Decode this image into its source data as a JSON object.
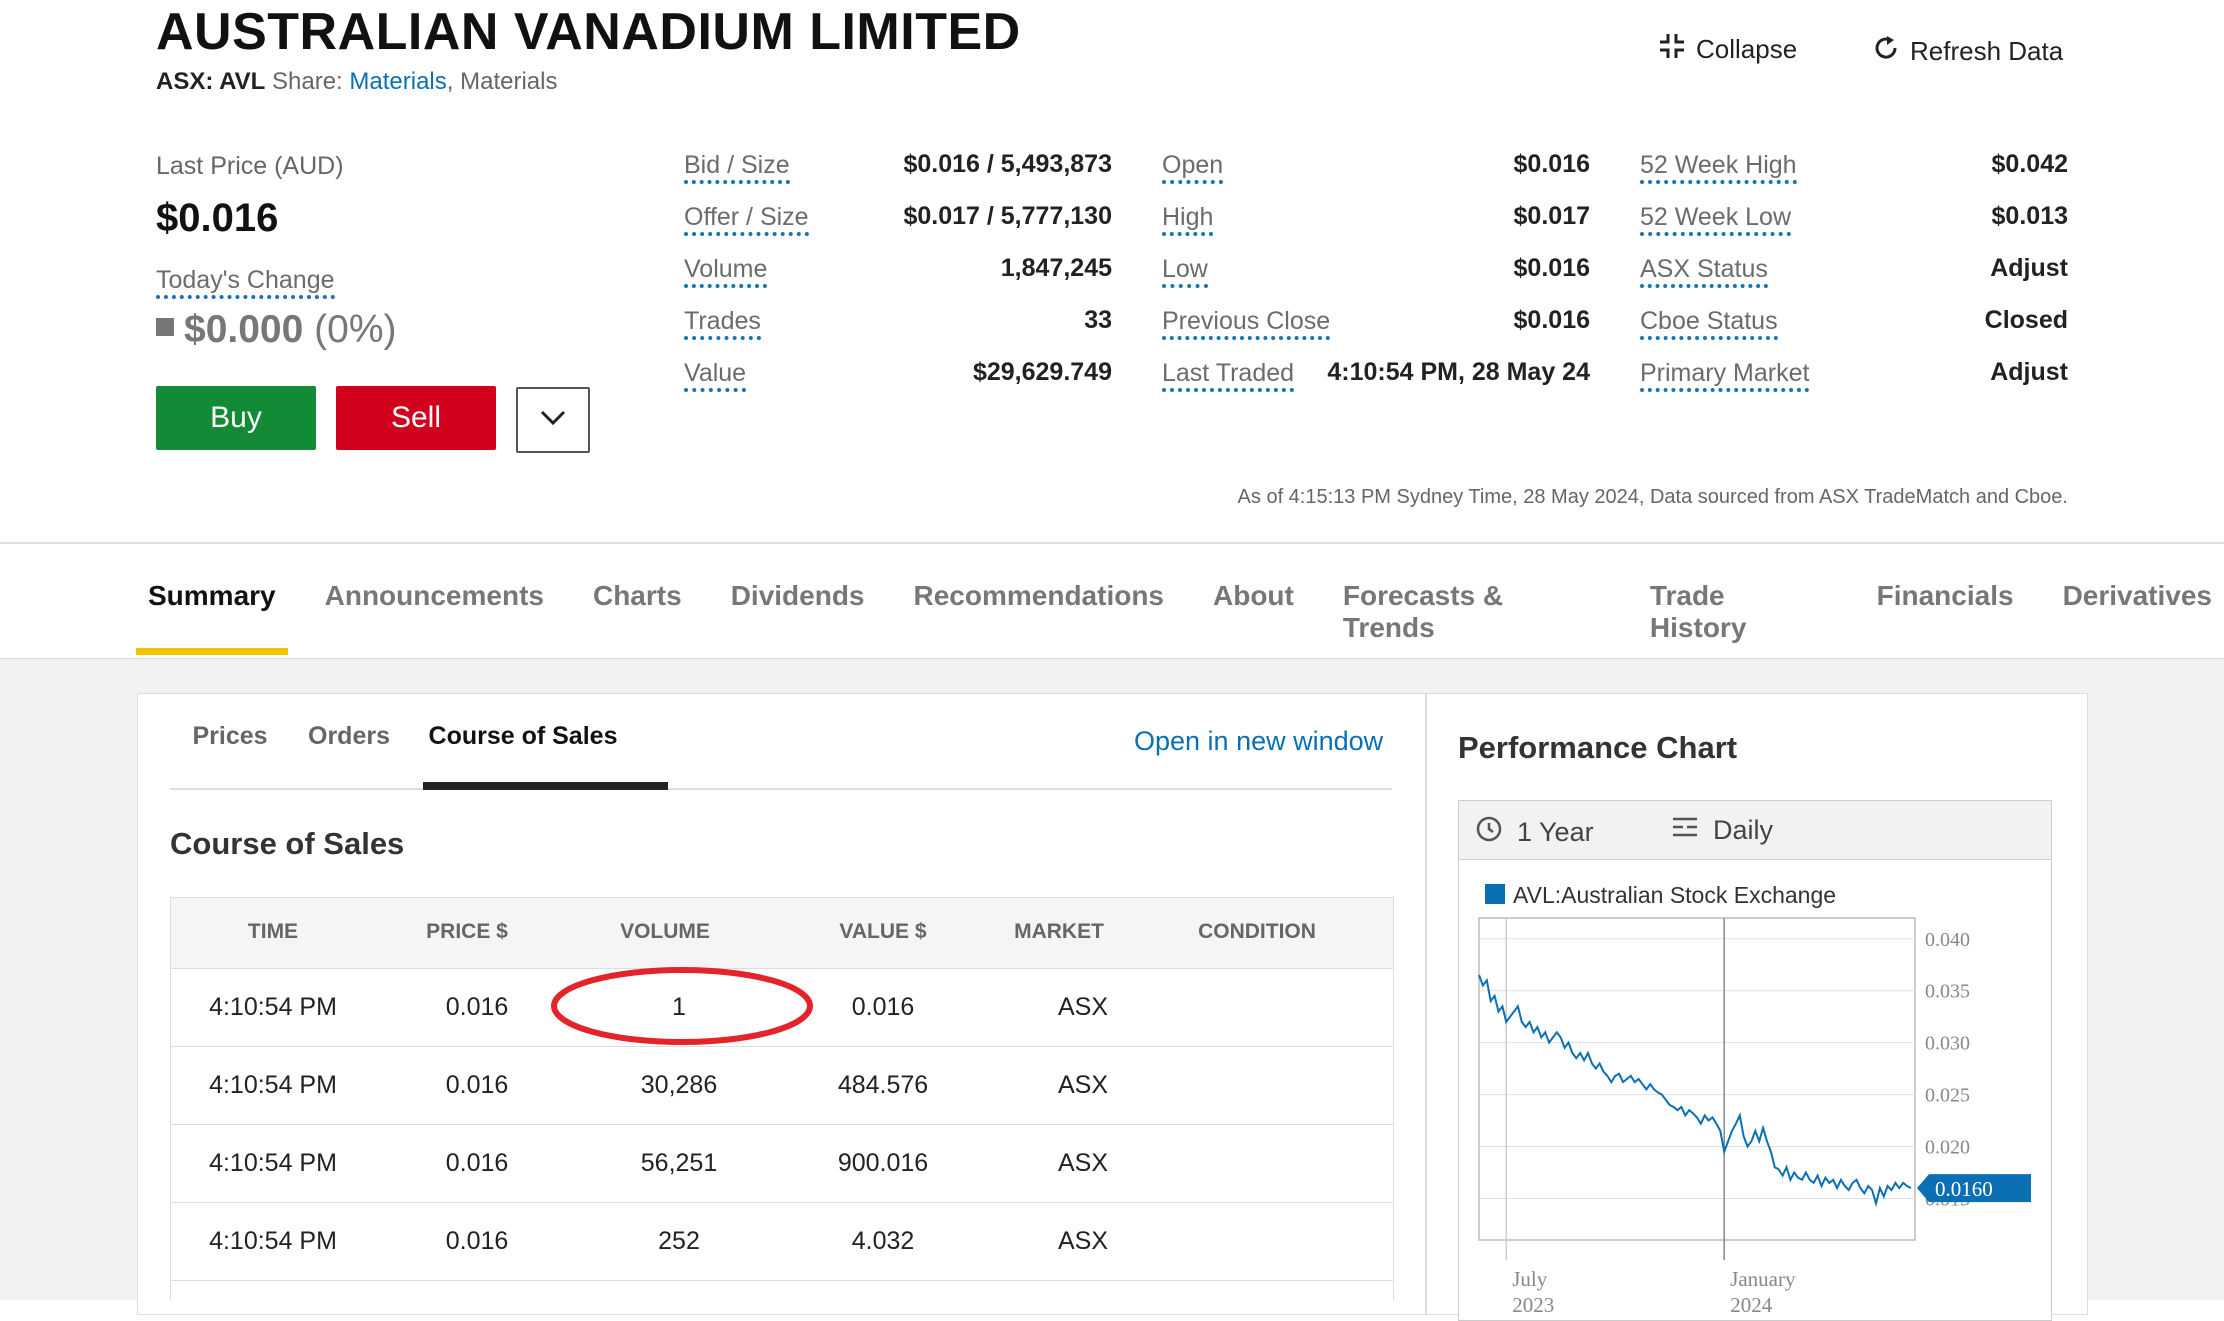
{
  "header": {
    "title": "AUSTRALIAN VANADIUM LIMITED",
    "ticker": "ASX: AVL",
    "share_label": "Share:",
    "sector_link": "Materials",
    "sector_rest": ", Materials",
    "collapse_label": "Collapse",
    "refresh_label": "Refresh Data"
  },
  "price": {
    "last_price_label": "Last Price (AUD)",
    "last_price": "$0.016",
    "todays_change_label": "Today's Change",
    "change_value": "$0.000",
    "change_pct": "(0%)",
    "buy_label": "Buy",
    "sell_label": "Sell"
  },
  "stats": {
    "col1": [
      {
        "label": "Bid / Size",
        "value": "$0.016 / 5,493,873"
      },
      {
        "label": "Offer / Size",
        "value": "$0.017 / 5,777,130"
      },
      {
        "label": "Volume",
        "value": "1,847,245"
      },
      {
        "label": "Trades",
        "value": "33"
      },
      {
        "label": "Value",
        "value": "$29,629.749"
      }
    ],
    "col2": [
      {
        "label": "Open",
        "value": "$0.016"
      },
      {
        "label": "High",
        "value": "$0.017"
      },
      {
        "label": "Low",
        "value": "$0.016"
      },
      {
        "label": "Previous Close",
        "value": "$0.016"
      },
      {
        "label": "Last Traded",
        "value": "4:10:54 PM, 28 May 24"
      }
    ],
    "col3": [
      {
        "label": "52 Week High",
        "value": "$0.042"
      },
      {
        "label": "52 Week Low",
        "value": "$0.013"
      },
      {
        "label": "ASX Status",
        "value": "Adjust"
      },
      {
        "label": "Cboe Status",
        "value": "Closed"
      },
      {
        "label": "Primary Market",
        "value": "Adjust"
      }
    ]
  },
  "as_of": "As of 4:15:13 PM Sydney Time, 28 May 2024, Data sourced from ASX TradeMatch and Cboe.",
  "main_tabs": [
    "Summary",
    "Announcements",
    "Charts",
    "Dividends",
    "Recommendations",
    "About",
    "Forecasts & Trends",
    "Trade History",
    "Financials",
    "Derivatives"
  ],
  "sub_tabs": [
    "Prices",
    "Orders",
    "Course of Sales"
  ],
  "open_new_window": "Open in new window",
  "section_title": "Course of Sales",
  "table": {
    "headers": [
      "TIME",
      "PRICE $",
      "VOLUME",
      "VALUE $",
      "MARKET",
      "CONDITION"
    ],
    "rows": [
      [
        "4:10:54 PM",
        "0.016",
        "1",
        "0.016",
        "ASX",
        ""
      ],
      [
        "4:10:54 PM",
        "0.016",
        "30,286",
        "484.576",
        "ASX",
        ""
      ],
      [
        "4:10:54 PM",
        "0.016",
        "56,251",
        "900.016",
        "ASX",
        ""
      ],
      [
        "4:10:54 PM",
        "0.016",
        "252",
        "4.032",
        "ASX",
        ""
      ]
    ]
  },
  "performance": {
    "title": "Performance Chart",
    "period": "1 Year",
    "interval": "Daily"
  },
  "chart_data": {
    "type": "line",
    "series": [
      {
        "name": "AVL:Australian Stock Exchange",
        "color": "#0b6fb3"
      }
    ],
    "x_ticks": [
      {
        "label": "July",
        "sub": "2023"
      },
      {
        "label": "January",
        "sub": "2024"
      }
    ],
    "y_ticks": [
      "0.040",
      "0.035",
      "0.030",
      "0.025",
      "0.020",
      "0.015"
    ],
    "ylim": [
      0.011,
      0.042
    ],
    "last_value_label": "0.0160",
    "values": [
      0.0365,
      0.0355,
      0.036,
      0.034,
      0.0345,
      0.033,
      0.0335,
      0.032,
      0.0325,
      0.033,
      0.0335,
      0.032,
      0.0315,
      0.032,
      0.031,
      0.0315,
      0.0305,
      0.031,
      0.03,
      0.0305,
      0.031,
      0.0305,
      0.0295,
      0.03,
      0.029,
      0.0285,
      0.029,
      0.0283,
      0.029,
      0.028,
      0.0275,
      0.028,
      0.0272,
      0.0268,
      0.0262,
      0.0268,
      0.027,
      0.0262,
      0.0265,
      0.0268,
      0.0262,
      0.0265,
      0.026,
      0.0255,
      0.026,
      0.0255,
      0.0252,
      0.025,
      0.0245,
      0.024,
      0.0238,
      0.0235,
      0.0238,
      0.023,
      0.0235,
      0.0232,
      0.0228,
      0.0222,
      0.023,
      0.0225,
      0.0228,
      0.0222,
      0.0215,
      0.0195,
      0.0205,
      0.0215,
      0.0222,
      0.023,
      0.021,
      0.02,
      0.0205,
      0.0215,
      0.0205,
      0.0218,
      0.0205,
      0.0195,
      0.018,
      0.0178,
      0.0172,
      0.018,
      0.0168,
      0.0175,
      0.017,
      0.0168,
      0.0175,
      0.0168,
      0.0165,
      0.0172,
      0.0162,
      0.017,
      0.0165,
      0.0168,
      0.016,
      0.0168,
      0.0162,
      0.0158,
      0.0165,
      0.0168,
      0.016,
      0.0155,
      0.0162,
      0.0158,
      0.0145,
      0.016,
      0.0152,
      0.0162,
      0.0158,
      0.0165,
      0.016,
      0.0165,
      0.0162,
      0.016
    ]
  }
}
